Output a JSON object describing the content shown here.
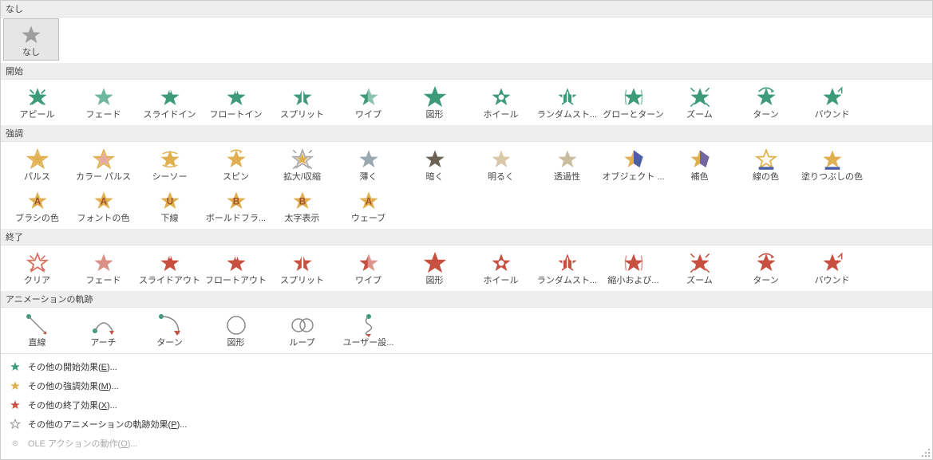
{
  "sections": {
    "none": {
      "label": "なし",
      "items": [
        {
          "label": "なし",
          "icon": "star",
          "color": "#9e9e9e",
          "selected": true
        }
      ]
    },
    "entrance": {
      "label": "開始",
      "items": [
        {
          "label": "アピール",
          "icon": "star-burst",
          "color": "#3e9b7a"
        },
        {
          "label": "フェード",
          "icon": "star-fade",
          "color": "#6fb8a0"
        },
        {
          "label": "スライドイン",
          "icon": "star-slide",
          "color": "#3e9b7a"
        },
        {
          "label": "フロートイン",
          "icon": "star-float",
          "color": "#3e9b7a"
        },
        {
          "label": "スプリット",
          "icon": "star-split",
          "color": "#3e9b7a"
        },
        {
          "label": "ワイプ",
          "icon": "star-wipe",
          "color": "#3e9b7a"
        },
        {
          "label": "図形",
          "icon": "star-shape",
          "color": "#3e9b7a"
        },
        {
          "label": "ホイール",
          "icon": "star-wheel",
          "color": "#3e9b7a"
        },
        {
          "label": "ランダムスト...",
          "icon": "star-random",
          "color": "#3e9b7a"
        },
        {
          "label": "グローとターン",
          "icon": "star-glow",
          "color": "#3e9b7a"
        },
        {
          "label": "ズーム",
          "icon": "star-zoom",
          "color": "#3e9b7a"
        },
        {
          "label": "ターン",
          "icon": "star-turn",
          "color": "#3e9b7a"
        },
        {
          "label": "バウンド",
          "icon": "star-bounce",
          "color": "#3e9b7a"
        }
      ]
    },
    "emphasis": {
      "label": "強調",
      "items": [
        {
          "label": "パルス",
          "icon": "star-pulse",
          "color": "#e0b050"
        },
        {
          "label": "カラー パルス",
          "icon": "star-colorpulse",
          "color": "#e0b050"
        },
        {
          "label": "シーソー",
          "icon": "star-seesaw",
          "color": "#e0b050"
        },
        {
          "label": "スピン",
          "icon": "star-spin",
          "color": "#e0b050"
        },
        {
          "label": "拡大/収縮",
          "icon": "star-grow",
          "color": "#e0b050"
        },
        {
          "label": "薄く",
          "icon": "star-desat",
          "color": "#9aa8b0"
        },
        {
          "label": "暗く",
          "icon": "star-dark",
          "color": "#6b6255"
        },
        {
          "label": "明るく",
          "icon": "star-light",
          "color": "#d9c9a8"
        },
        {
          "label": "透過性",
          "icon": "star-trans",
          "color": "#c9bda0"
        },
        {
          "label": "オブジェクト ...",
          "icon": "star-objcolor",
          "color": "#4b5fa8"
        },
        {
          "label": "補色",
          "icon": "star-comp",
          "color": "#7464a0"
        },
        {
          "label": "線の色",
          "icon": "star-linecolor",
          "color": "#e0b050"
        },
        {
          "label": "塗りつぶしの色",
          "icon": "star-fillcolor",
          "color": "#e0b050"
        },
        {
          "label": "ブラシの色",
          "icon": "star-brush",
          "color": "#e0b050",
          "letter": "A"
        },
        {
          "label": "フォントの色",
          "icon": "star-fontcolor",
          "color": "#e0b050",
          "letter": "A"
        },
        {
          "label": "下線",
          "icon": "star-underline",
          "color": "#e0b050",
          "letter": "U"
        },
        {
          "label": "ボールドフラ...",
          "icon": "star-bold",
          "color": "#e0b050",
          "letter": "B"
        },
        {
          "label": "太字表示",
          "icon": "star-boldrev",
          "color": "#e0b050",
          "letter": "B"
        },
        {
          "label": "ウェーブ",
          "icon": "star-wave",
          "color": "#e0b050",
          "letter": "A"
        }
      ]
    },
    "exit": {
      "label": "終了",
      "items": [
        {
          "label": "クリア",
          "icon": "star-clear",
          "color": "#d87060"
        },
        {
          "label": "フェード",
          "icon": "star-fade",
          "color": "#da9085"
        },
        {
          "label": "スライドアウト",
          "icon": "star-slide",
          "color": "#c85040"
        },
        {
          "label": "フロートアウト",
          "icon": "star-float",
          "color": "#c85040"
        },
        {
          "label": "スプリット",
          "icon": "star-split",
          "color": "#c85040"
        },
        {
          "label": "ワイプ",
          "icon": "star-wipe",
          "color": "#c85040"
        },
        {
          "label": "図形",
          "icon": "star-shape",
          "color": "#c85040"
        },
        {
          "label": "ホイール",
          "icon": "star-wheel",
          "color": "#c85040"
        },
        {
          "label": "ランダムスト...",
          "icon": "star-random",
          "color": "#c85040"
        },
        {
          "label": "縮小および...",
          "icon": "star-shrink",
          "color": "#c85040"
        },
        {
          "label": "ズーム",
          "icon": "star-zoom",
          "color": "#c85040"
        },
        {
          "label": "ターン",
          "icon": "star-turn",
          "color": "#c85040"
        },
        {
          "label": "バウンド",
          "icon": "star-bounce",
          "color": "#c85040"
        }
      ]
    },
    "motion": {
      "label": "アニメーションの軌跡",
      "items": [
        {
          "label": "直線",
          "icon": "path-line"
        },
        {
          "label": "アーチ",
          "icon": "path-arc"
        },
        {
          "label": "ターン",
          "icon": "path-turn"
        },
        {
          "label": "図形",
          "icon": "path-shape"
        },
        {
          "label": "ループ",
          "icon": "path-loop"
        },
        {
          "label": "ユーザー設...",
          "icon": "path-custom"
        }
      ]
    }
  },
  "menu": {
    "more_entrance": {
      "text": "その他の開始効果(",
      "key": "E",
      "suffix": ")...",
      "color": "#3e9b7a"
    },
    "more_emphasis": {
      "text": "その他の強調効果(",
      "key": "M",
      "suffix": ")...",
      "color": "#e0b050"
    },
    "more_exit": {
      "text": "その他の終了効果(",
      "key": "X",
      "suffix": ")...",
      "color": "#c85040"
    },
    "more_motion": {
      "text": "その他のアニメーションの軌跡効果(",
      "key": "P",
      "suffix": ")...",
      "color": "#888"
    },
    "ole": {
      "text": "OLE アクションの動作(",
      "key": "O",
      "suffix": ")...",
      "color": "#ccc",
      "disabled": true
    }
  }
}
